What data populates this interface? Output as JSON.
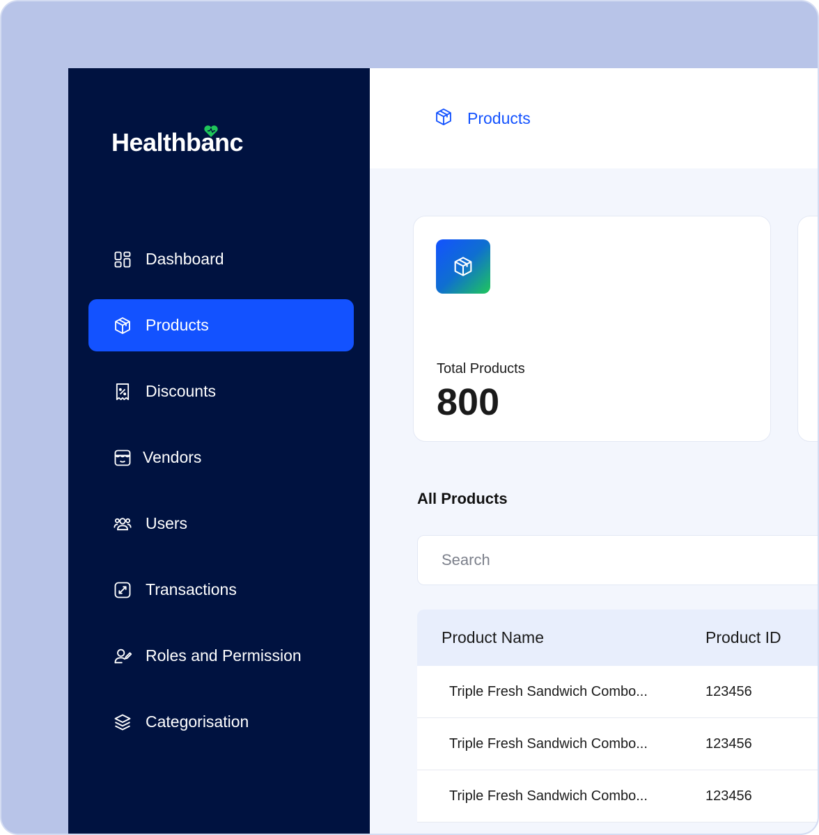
{
  "brand": {
    "name": "Healthbanc",
    "accent": "#1352ff",
    "sidebar_bg": "#001240",
    "heart_color": "#1fc65a"
  },
  "sidebar": {
    "items": [
      {
        "label": "Dashboard",
        "icon": "dashboard-grid-icon",
        "active": false
      },
      {
        "label": "Products",
        "icon": "box-icon",
        "active": true
      },
      {
        "label": "Discounts",
        "icon": "discount-receipt-icon",
        "active": false
      },
      {
        "label": "Vendors",
        "icon": "store-icon",
        "active": false
      },
      {
        "label": "Users",
        "icon": "users-icon",
        "active": false
      },
      {
        "label": "Transactions",
        "icon": "transaction-icon",
        "active": false
      },
      {
        "label": "Roles and Permission",
        "icon": "user-edit-icon",
        "active": false
      },
      {
        "label": "Categorisation",
        "icon": "layers-icon",
        "active": false
      }
    ]
  },
  "header": {
    "title": "Products",
    "icon": "box-icon"
  },
  "stats": [
    {
      "label": "Total Products",
      "value": "800",
      "icon": "box-icon"
    }
  ],
  "products": {
    "title": "All Products",
    "search_placeholder": "Search",
    "columns": [
      "Product Name",
      "Product ID"
    ],
    "rows": [
      [
        "Triple Fresh Sandwich Combo...",
        "123456"
      ],
      [
        "Triple Fresh Sandwich Combo...",
        "123456"
      ],
      [
        "Triple Fresh Sandwich Combo...",
        "123456"
      ]
    ]
  }
}
